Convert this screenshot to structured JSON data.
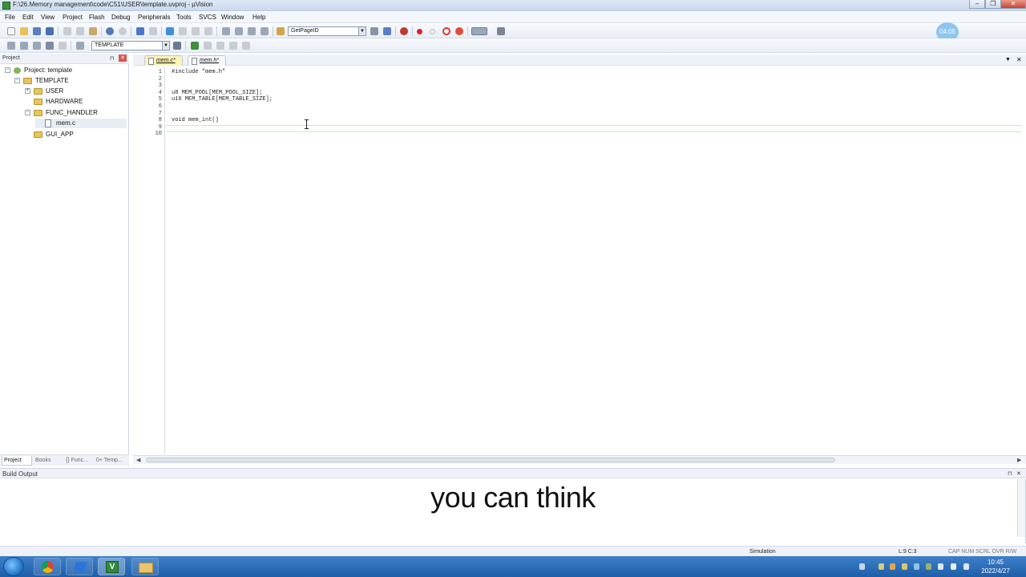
{
  "window": {
    "title": "F:\\26.Memory management\\code\\C51\\USER\\template.uvproj - µVision"
  },
  "menu": [
    "File",
    "Edit",
    "View",
    "Project",
    "Flash",
    "Debug",
    "Peripherals",
    "Tools",
    "SVCS",
    "Window",
    "Help"
  ],
  "toolbar1": {
    "find_combo_value": "GetPageID"
  },
  "toolbar2": {
    "target_combo_value": "TEMPLATE"
  },
  "timer": "04:05",
  "project_panel": {
    "header": "Project",
    "tree": {
      "root": "Project: template",
      "target": "TEMPLATE",
      "groups": [
        "USER",
        "HARDWARE",
        "FUNC_HANDLER",
        "GUI_APP"
      ],
      "file": "mem.c"
    },
    "tabs": [
      "Project",
      "Books",
      "{} Func...",
      "0+ Temp..."
    ]
  },
  "editor": {
    "tabs": [
      {
        "label": "mem.c*",
        "active": true
      },
      {
        "label": "mem.h*",
        "active": false
      }
    ],
    "line_numbers": [
      "1",
      "2",
      "3",
      "4",
      "5",
      "6",
      "7",
      "8",
      "9",
      "10"
    ],
    "lines": [
      "#include \"mem.h\"",
      "",
      "",
      "u8 MEM_POOL[MEM_POOL_SIZE];",
      "u16 MEM_TABLE[MEM_TABLE_SIZE];",
      "",
      "",
      "void mem_int()",
      "",
      ""
    ]
  },
  "build_output": {
    "header": "Build Output"
  },
  "subtitle": "you can think",
  "status": {
    "mode": "Simulation",
    "position": "L:9 C:3",
    "indicators": "CAP  NUM  SCRL  OVR  R/W"
  },
  "taskbar": {
    "time": "10:45",
    "date": "2022/4/27"
  }
}
